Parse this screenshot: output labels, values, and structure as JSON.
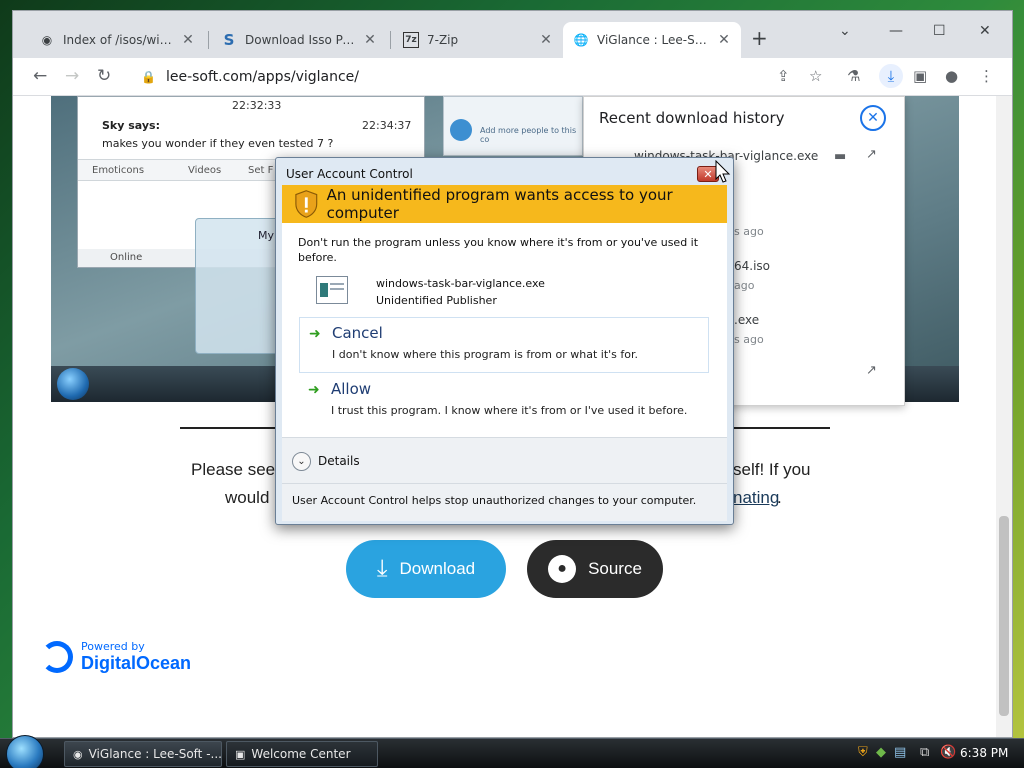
{
  "browser": {
    "tabs": [
      {
        "title": "Index of /isos/windo",
        "icon": "github-icon"
      },
      {
        "title": "Download Isso Pack",
        "icon": "s-logo-icon"
      },
      {
        "title": "7-Zip",
        "icon": "7zip-icon"
      },
      {
        "title": "ViGlance : Lee-Soft",
        "icon": "globe-icon",
        "active": true
      }
    ],
    "url": "lee-soft.com/apps/viglance/",
    "accent": "#1a73e8"
  },
  "page": {
    "chat": {
      "time1": "22:32:33",
      "sender": "Sky says:",
      "time2": "22:34:37",
      "message": "makes you wonder if they even tested 7 ?",
      "toolbar_items": [
        "Emoticons",
        "Videos",
        "Set F"
      ],
      "status": "Online"
    },
    "inner_window_label": "My",
    "add_more": "Add more people to this co",
    "para_line1_start": "Please see",
    "para_line1_end": "self! If you",
    "para_line2_start": "would",
    "para_line2_link": "nating",
    "para_line2_end": ".",
    "download_button": "Download",
    "source_button": "Source",
    "powered_by": "Powered by",
    "powered_brand": "DigitalOcean"
  },
  "downloads": {
    "title": "Recent download history",
    "items": [
      {
        "name": "windows-task-bar-viglance.exe",
        "meta": ""
      },
      {
        "name": "",
        "meta": "s ago"
      },
      {
        "name": "64.iso",
        "meta": "ago"
      },
      {
        "name": ".exe",
        "meta": "s ago"
      }
    ]
  },
  "uac": {
    "title": "User Account Control",
    "banner": "An unidentified program wants access to your computer",
    "warning": "Don't run the program unless you know where it's from or you've used it before.",
    "program_name": "windows-task-bar-viglance.exe",
    "publisher": "Unidentified Publisher",
    "cancel_label": "Cancel",
    "cancel_desc": "I don't know where this program is from or what it's for.",
    "allow_label": "Allow",
    "allow_desc": "I trust this program. I know where it's from or I've used it before.",
    "details": "Details",
    "footer": "User Account Control helps stop unauthorized changes to your computer.",
    "banner_color": "#f6b81c"
  },
  "taskbar": {
    "buttons": [
      "ViGlance : Lee-Soft -...",
      "Welcome Center"
    ],
    "clock": "6:38 PM"
  }
}
